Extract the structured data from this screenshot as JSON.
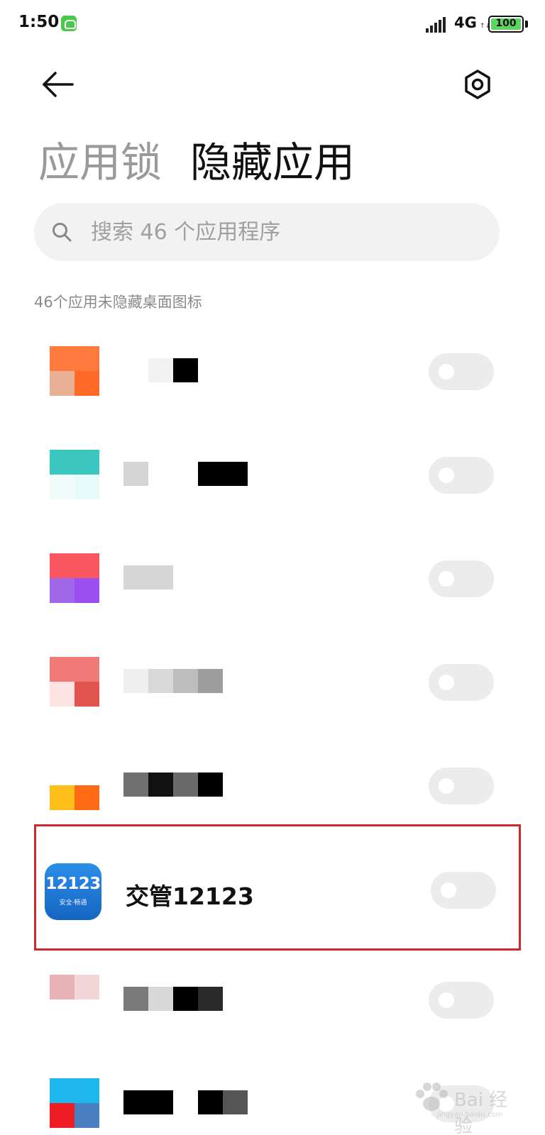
{
  "status_bar": {
    "time": "1:50",
    "network": "4G",
    "battery": "100"
  },
  "header": {
    "back_icon": "back-arrow-icon",
    "settings_icon": "settings-hexagon-icon"
  },
  "tabs": [
    {
      "label": "应用锁",
      "active": false
    },
    {
      "label": "隐藏应用",
      "active": true
    }
  ],
  "search": {
    "placeholder": "搜索 46 个应用程序"
  },
  "section": {
    "label": "46个应用未隐藏桌面图标"
  },
  "apps": [
    {
      "name": "",
      "blurred": true,
      "enabled": false
    },
    {
      "name": "",
      "blurred": true,
      "enabled": false
    },
    {
      "name": "",
      "blurred": true,
      "enabled": false
    },
    {
      "name": "",
      "blurred": true,
      "enabled": false
    },
    {
      "name": "",
      "blurred": true,
      "enabled": false
    },
    {
      "name": "交管12123",
      "blurred": false,
      "enabled": false,
      "highlighted": true,
      "icon_text": "12123",
      "icon_subtext": "安全·畅通"
    },
    {
      "name": "",
      "blurred": true,
      "enabled": false
    },
    {
      "name": "",
      "blurred": true,
      "enabled": false
    }
  ],
  "colors": {
    "highlight_border": "#cc2a2f",
    "toggle_off": "#ececec",
    "tab_inactive": "#9a9a9a"
  },
  "watermark": {
    "text": "Bai 经验",
    "sub": "jingyan.baidu.com"
  }
}
